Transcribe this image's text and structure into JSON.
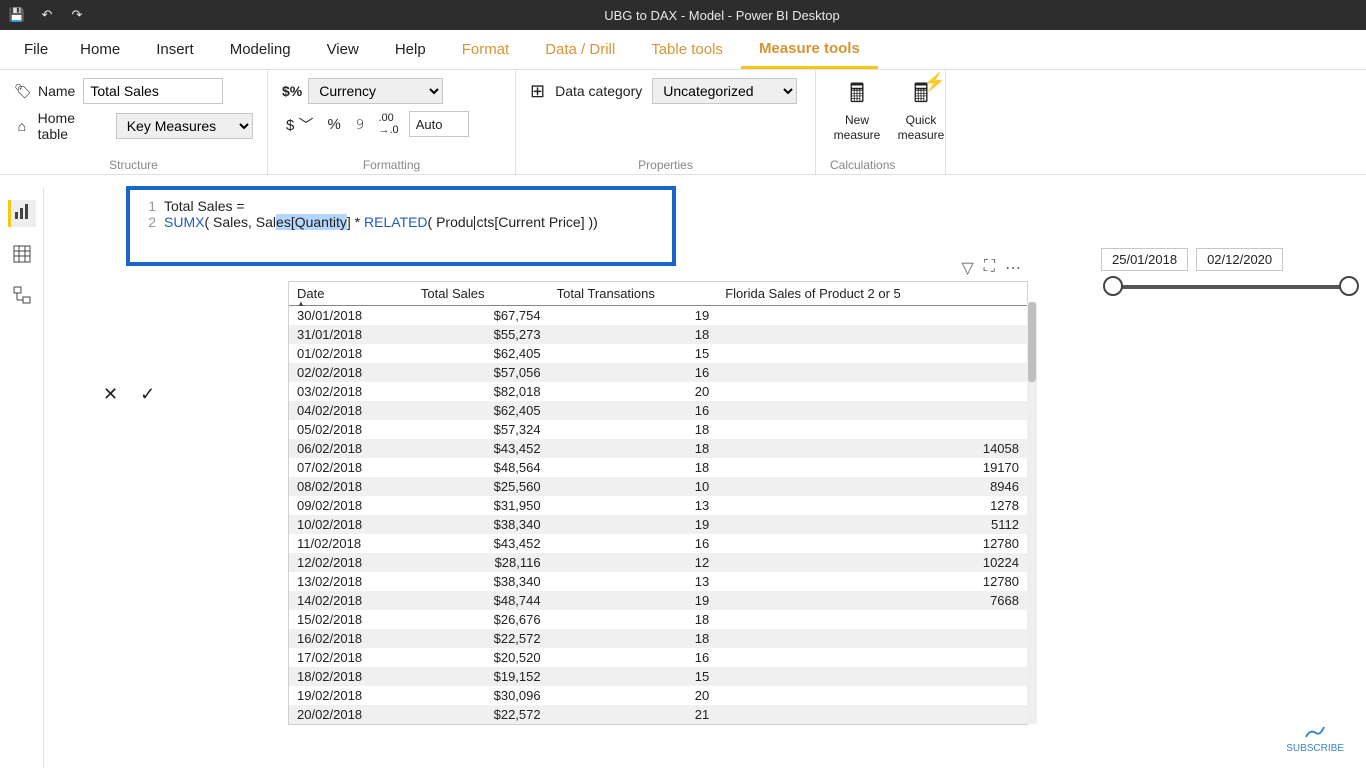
{
  "titlebar": {
    "title": "UBG to DAX - Model - Power BI Desktop"
  },
  "menu": {
    "file": "File",
    "home": "Home",
    "insert": "Insert",
    "modeling": "Modeling",
    "view": "View",
    "help": "Help",
    "format": "Format",
    "datadrill": "Data / Drill",
    "tabletools": "Table tools",
    "measuretools": "Measure tools"
  },
  "ribbon": {
    "structure_label": "Structure",
    "name_label": "Name",
    "name_value": "Total Sales",
    "hometable_label": "Home table",
    "hometable_value": "Key Measures",
    "format_label": "Formatting",
    "format_value": "Currency",
    "decimals_value": "Auto",
    "props_label": "Properties",
    "datacat_label": "Data category",
    "datacat_value": "Uncategorized",
    "calc_label": "Calculations",
    "newmeasure": "New measure",
    "quickmeasure": "Quick measure"
  },
  "formula": {
    "line1_prefix": "Total Sales =",
    "line2_fn": "SUMX",
    "line2_a": "( Sales, Sal",
    "line2_hl": "es[Quantity",
    "line2_b": "] * ",
    "line2_rel": "RELATED",
    "line2_c": "( Pro",
    "line2_caret": "du",
    "line2_d": "cts[Current Price] ))"
  },
  "slicer": {
    "start": "25/01/2018",
    "end": "02/12/2020"
  },
  "table": {
    "headers": {
      "date": "Date",
      "ts": "Total Sales",
      "tt": "Total Transations",
      "fl": "Florida Sales of Product 2 or 5"
    },
    "rows": [
      {
        "date": "30/01/2018",
        "ts": "$67,754",
        "tt": "19",
        "fl": ""
      },
      {
        "date": "31/01/2018",
        "ts": "$55,273",
        "tt": "18",
        "fl": ""
      },
      {
        "date": "01/02/2018",
        "ts": "$62,405",
        "tt": "15",
        "fl": ""
      },
      {
        "date": "02/02/2018",
        "ts": "$57,056",
        "tt": "16",
        "fl": ""
      },
      {
        "date": "03/02/2018",
        "ts": "$82,018",
        "tt": "20",
        "fl": ""
      },
      {
        "date": "04/02/2018",
        "ts": "$62,405",
        "tt": "16",
        "fl": ""
      },
      {
        "date": "05/02/2018",
        "ts": "$57,324",
        "tt": "18",
        "fl": ""
      },
      {
        "date": "06/02/2018",
        "ts": "$43,452",
        "tt": "18",
        "fl": "14058"
      },
      {
        "date": "07/02/2018",
        "ts": "$48,564",
        "tt": "18",
        "fl": "19170"
      },
      {
        "date": "08/02/2018",
        "ts": "$25,560",
        "tt": "10",
        "fl": "8946"
      },
      {
        "date": "09/02/2018",
        "ts": "$31,950",
        "tt": "13",
        "fl": "1278"
      },
      {
        "date": "10/02/2018",
        "ts": "$38,340",
        "tt": "19",
        "fl": "5112"
      },
      {
        "date": "11/02/2018",
        "ts": "$43,452",
        "tt": "16",
        "fl": "12780"
      },
      {
        "date": "12/02/2018",
        "ts": "$28,116",
        "tt": "12",
        "fl": "10224"
      },
      {
        "date": "13/02/2018",
        "ts": "$38,340",
        "tt": "13",
        "fl": "12780"
      },
      {
        "date": "14/02/2018",
        "ts": "$48,744",
        "tt": "19",
        "fl": "7668"
      },
      {
        "date": "15/02/2018",
        "ts": "$26,676",
        "tt": "18",
        "fl": ""
      },
      {
        "date": "16/02/2018",
        "ts": "$22,572",
        "tt": "18",
        "fl": ""
      },
      {
        "date": "17/02/2018",
        "ts": "$20,520",
        "tt": "16",
        "fl": ""
      },
      {
        "date": "18/02/2018",
        "ts": "$19,152",
        "tt": "15",
        "fl": ""
      },
      {
        "date": "19/02/2018",
        "ts": "$30,096",
        "tt": "20",
        "fl": ""
      },
      {
        "date": "20/02/2018",
        "ts": "$22,572",
        "tt": "21",
        "fl": ""
      }
    ]
  },
  "subscribe": "SUBSCRIBE"
}
